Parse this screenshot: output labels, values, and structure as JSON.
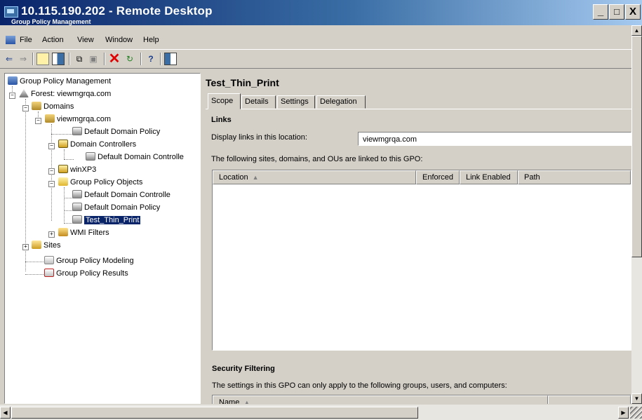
{
  "window": {
    "title": "10.115.190.202 - Remote Desktop",
    "inner_title": "Group Policy Management",
    "controls": {
      "minimize": "_",
      "restore": "□",
      "close": "X"
    }
  },
  "menu": [
    "File",
    "Action",
    "View",
    "Window",
    "Help"
  ],
  "toolbar": [
    "back-icon",
    "forward-icon",
    "up-folder-icon",
    "show-hide-tree-icon",
    "copy-icon",
    "paste-icon",
    "delete-icon",
    "refresh-icon",
    "help-icon",
    "action-pane-icon"
  ],
  "tree": {
    "root": "Group Policy Management",
    "forest": "Forest: viewmgrqa.com",
    "domains": "Domains",
    "domain": "viewmgrqa.com",
    "default_domain_policy": "Default Domain Policy",
    "domain_controllers": "Domain Controllers",
    "default_domain_controllers_policy_link": "Default Domain Controlle",
    "winxp3": "winXP3",
    "gpo_container": "Group Policy Objects",
    "gpo_items": [
      "Default Domain Controlle",
      "Default Domain Policy",
      "Test_Thin_Print"
    ],
    "wmi_filters": "WMI Filters",
    "sites": "Sites",
    "modeling": "Group Policy Modeling",
    "results": "Group Policy Results"
  },
  "details": {
    "title": "Test_Thin_Print",
    "tabs": [
      "Scope",
      "Details",
      "Settings",
      "Delegation"
    ],
    "links_heading": "Links",
    "display_links_label": "Display links in this location:",
    "display_links_value": "viewmgrqa.com",
    "linked_text": "The following sites, domains, and OUs are linked to this GPO:",
    "link_columns": [
      "Location",
      "Enforced",
      "Link Enabled",
      "Path"
    ],
    "security_heading": "Security Filtering",
    "security_text": "The settings in this GPO can only apply to the following groups, users, and computers:",
    "security_columns": [
      "Name"
    ]
  }
}
